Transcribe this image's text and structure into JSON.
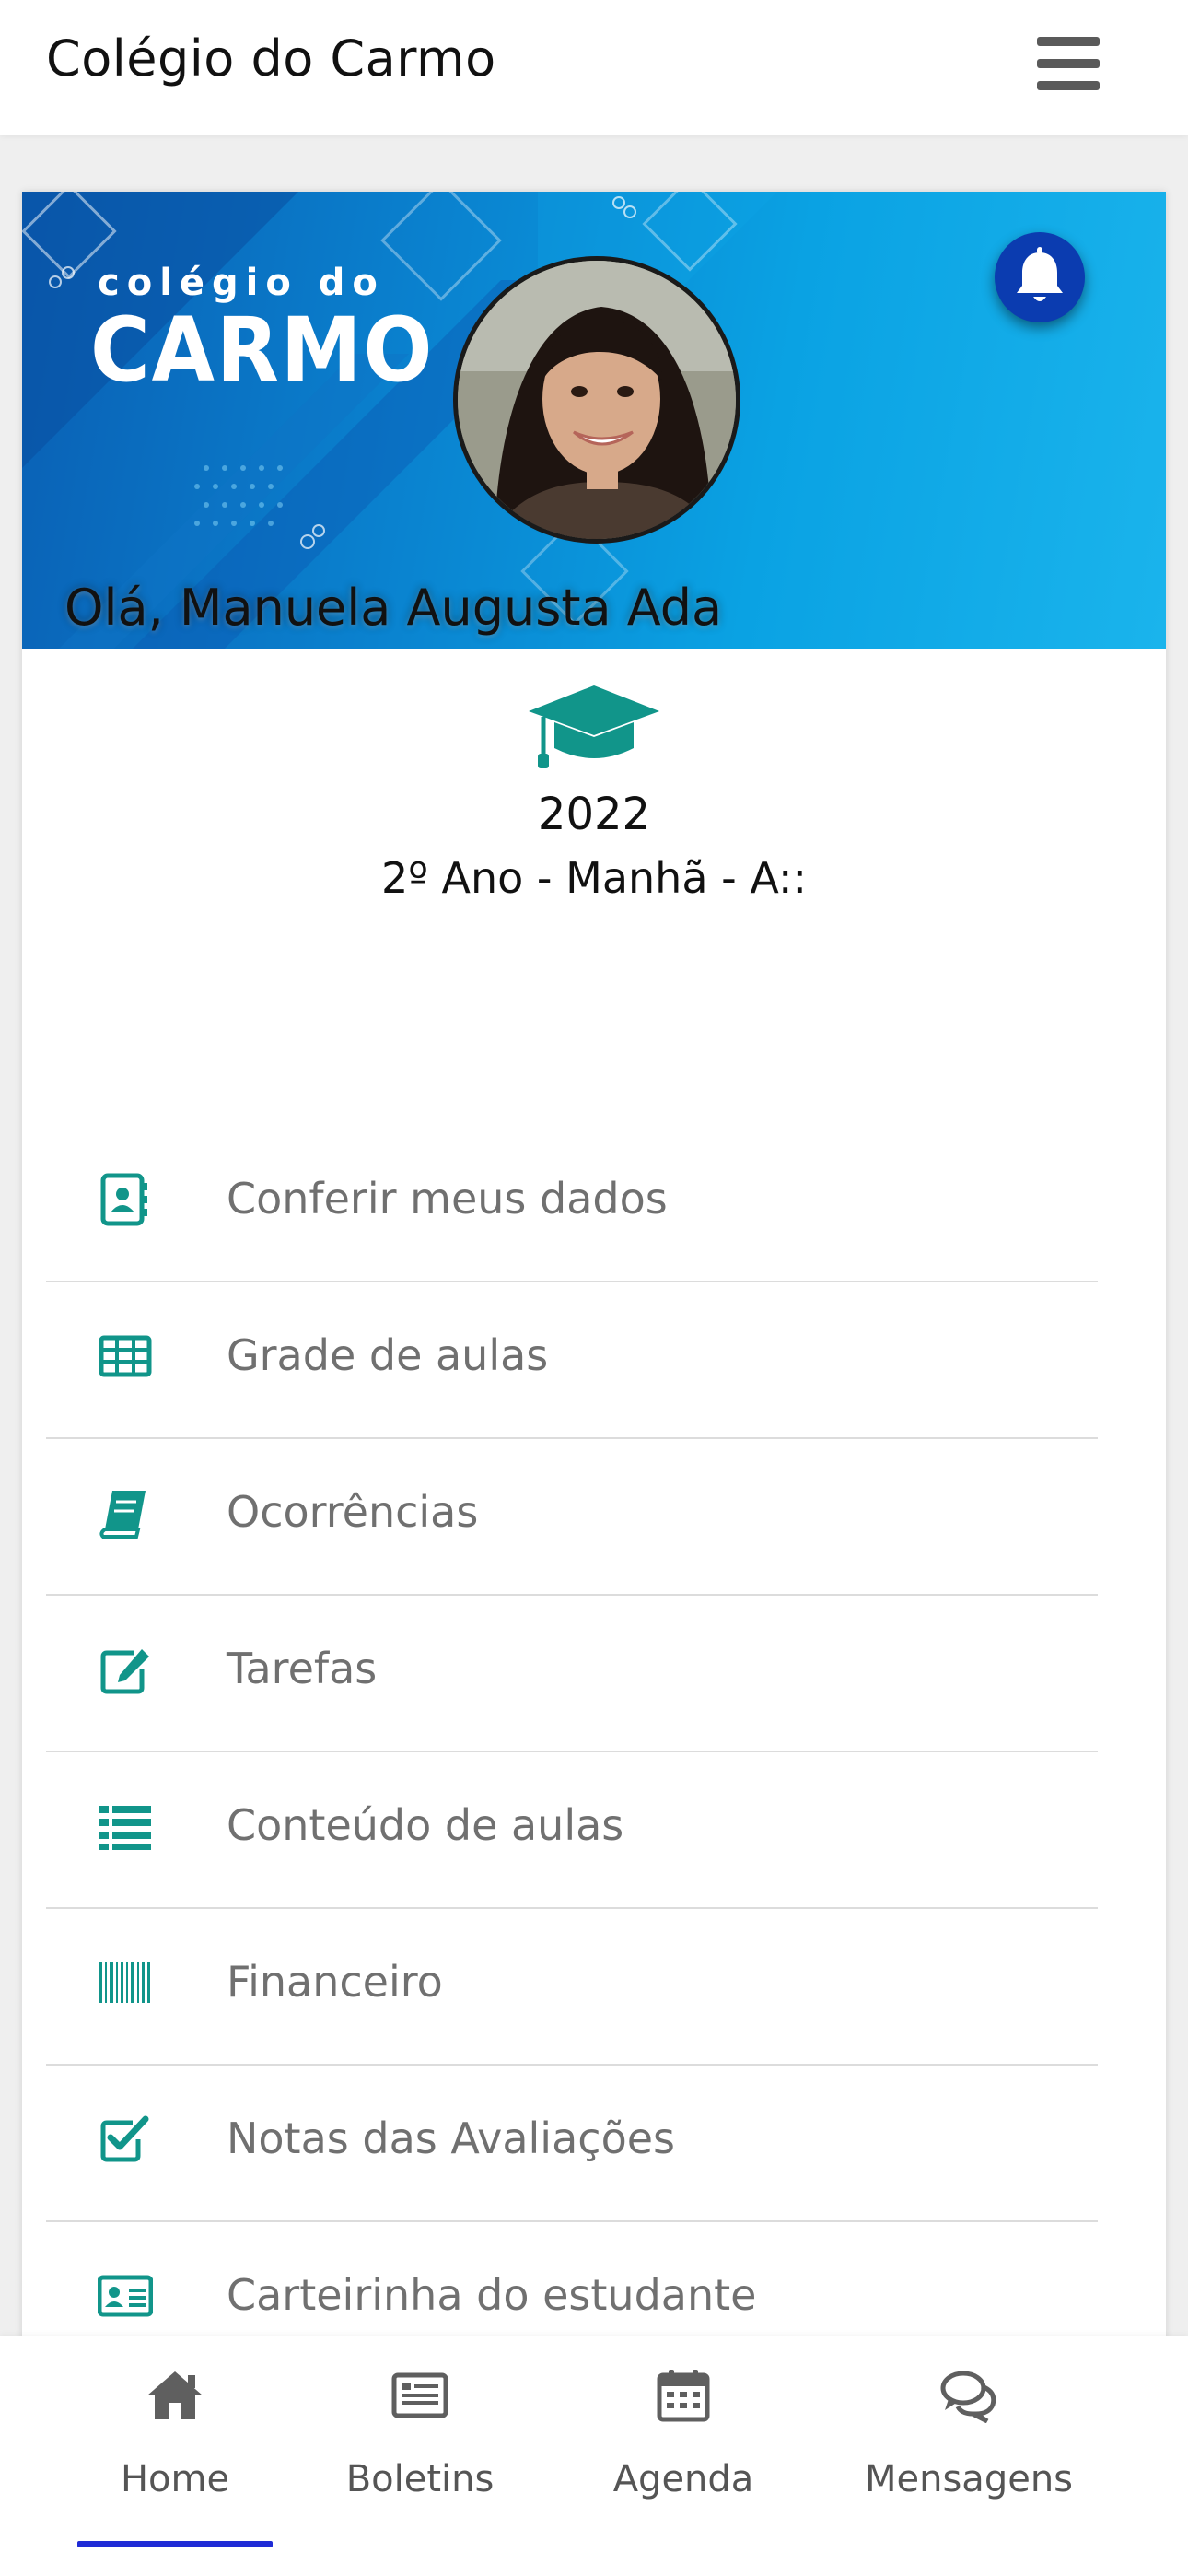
{
  "header": {
    "title": "Colégio do Carmo"
  },
  "hero": {
    "logo_top": "colégio do",
    "logo_bottom": "CARMO",
    "greeting": "Olá, Manuela Augusta Ada"
  },
  "student": {
    "year": "2022",
    "class_info": "2º Ano - Manhã - A::"
  },
  "menu": {
    "items": [
      {
        "label": "Conferir meus dados",
        "icon": "contact-card-icon"
      },
      {
        "label": "Grade de aulas",
        "icon": "table-grid-icon"
      },
      {
        "label": "Ocorrências",
        "icon": "book-icon"
      },
      {
        "label": "Tarefas",
        "icon": "edit-icon"
      },
      {
        "label": "Conteúdo de aulas",
        "icon": "list-icon"
      },
      {
        "label": "Financeiro",
        "icon": "barcode-icon"
      },
      {
        "label": "Notas das Avaliações",
        "icon": "check-square-icon"
      },
      {
        "label": "Carteirinha do estudante",
        "icon": "id-card-icon"
      }
    ]
  },
  "bottom_nav": {
    "items": [
      {
        "label": "Home",
        "icon": "home-icon",
        "active": true
      },
      {
        "label": "Boletins",
        "icon": "newspaper-icon",
        "active": false
      },
      {
        "label": "Agenda",
        "icon": "calendar-icon",
        "active": false
      },
      {
        "label": "Mensagens",
        "icon": "chat-bubbles-icon",
        "active": false
      }
    ]
  },
  "colors": {
    "accent_teal": "#11958a",
    "active_nav_bar": "#1f2bd6",
    "bell_background": "#0b3cb0",
    "hero_blue": "#0a82cf"
  }
}
